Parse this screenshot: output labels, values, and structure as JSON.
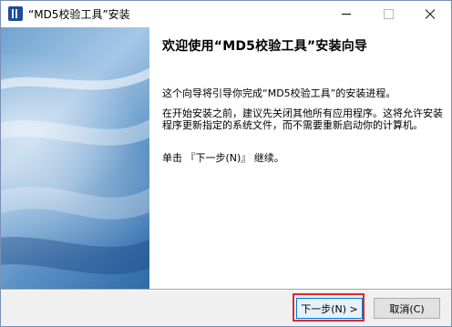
{
  "window": {
    "title": "“MD5校验工具”安装"
  },
  "page": {
    "heading": "欢迎使用“MD5校验工具”安装向导",
    "paragraph1": "这个向导将引导你完成“MD5校验工具”的安装进程。",
    "paragraph2": "在开始安装之前，建议先关闭其他所有应用程序。这将允许安装程序更新指定的系统文件，而不需要重新启动你的计算机。",
    "paragraph3": "单击 『下一步(N)』 继续。"
  },
  "buttons": {
    "next": "下一步(N) >",
    "cancel": "取消(C)"
  },
  "colors": {
    "highlight": "#e0282e",
    "banner_dark": "#2f6aa9",
    "banner_light": "#a6c7e6"
  },
  "icons": {
    "app": "installer-icon",
    "minimize": "minimize-icon",
    "maximize": "maximize-icon",
    "close": "close-icon"
  }
}
